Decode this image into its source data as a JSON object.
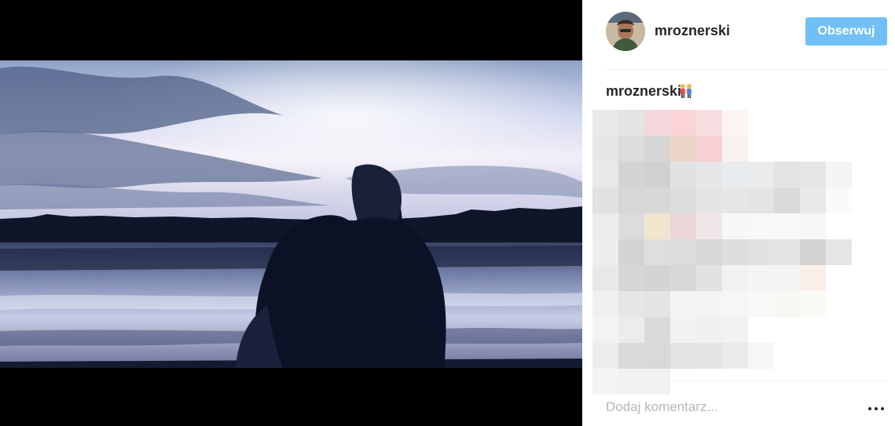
{
  "post": {
    "author": "mroznerski",
    "follow_label": "Obserwuj",
    "caption_author": "mroznerski",
    "caption_emoji_icon": "couple-holding-hands-icon",
    "caption_text_redacted": true,
    "photo_alt": "Two people in hoodies sitting by a lake at dusk"
  },
  "comment_box": {
    "placeholder": "Dodaj komentarz...",
    "more_icon": "more-options-icon"
  },
  "colors": {
    "follow_button": "#70c0f5",
    "text": "#262626",
    "placeholder": "#b6b6b6",
    "divider": "#efefef",
    "media_background": "#000000"
  }
}
